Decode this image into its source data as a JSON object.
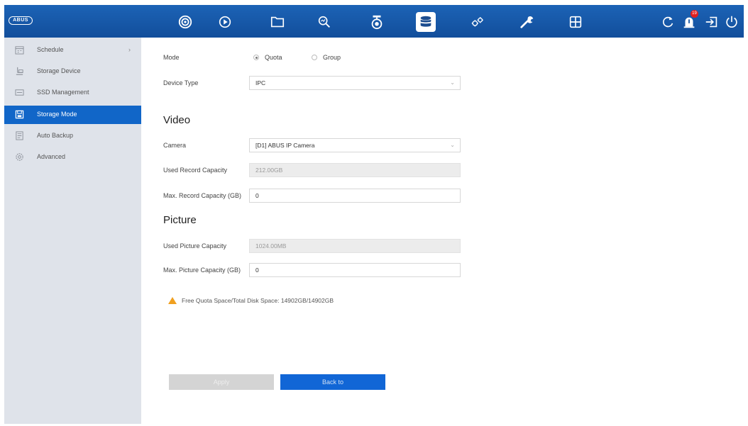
{
  "app": {
    "logo_text": "ABUS"
  },
  "topbar": {
    "nav_icons": [
      "live-view-icon",
      "playback-icon",
      "file-management-icon",
      "smart-analysis-icon",
      "camera-icon",
      "storage-icon",
      "system-settings-icon",
      "maintenance-icon",
      "apps-icon"
    ],
    "active": "storage-icon",
    "right_icons": [
      "refresh-icon",
      "alarm-icon",
      "logout-icon",
      "power-icon"
    ],
    "alarm_count": "19"
  },
  "sidebar": {
    "items": [
      {
        "label": "Schedule",
        "icon": "schedule-icon",
        "has_arrow": true,
        "arrow": "›"
      },
      {
        "label": "Storage Device",
        "icon": "storage-device-icon"
      },
      {
        "label": "SSD Management",
        "icon": "ssd-icon"
      },
      {
        "label": "Storage Mode",
        "icon": "storage-mode-icon",
        "active": true
      },
      {
        "label": "Auto Backup",
        "icon": "backup-icon"
      },
      {
        "label": "Advanced",
        "icon": "advanced-icon"
      }
    ]
  },
  "form": {
    "mode_label": "Mode",
    "mode_options": [
      {
        "label": "Quota",
        "selected": true
      },
      {
        "label": "Group",
        "selected": false
      }
    ],
    "device_type_label": "Device Type",
    "device_type_value": "IPC",
    "video_title": "Video",
    "camera_label": "Camera",
    "camera_value": "[D1] ABUS IP Camera",
    "used_record_label": "Used Record Capacity",
    "used_record_value": "212.00GB",
    "max_record_label": "Max. Record Capacity (GB)",
    "max_record_value": "0",
    "picture_title": "Picture",
    "used_picture_label": "Used Picture Capacity",
    "used_picture_value": "1024.00MB",
    "max_picture_label": "Max. Picture Capacity (GB)",
    "max_picture_value": "0",
    "caret": "⌄",
    "warning_text": "Free Quota Space/Total Disk Space: 14902GB/14902GB"
  },
  "buttons": {
    "apply": "Apply",
    "back": "Back to"
  },
  "colors": {
    "topbar": "#1658a8",
    "accent": "#1166d6",
    "sidebar_bg": "#dfe3ea",
    "warning": "#f0a020"
  }
}
